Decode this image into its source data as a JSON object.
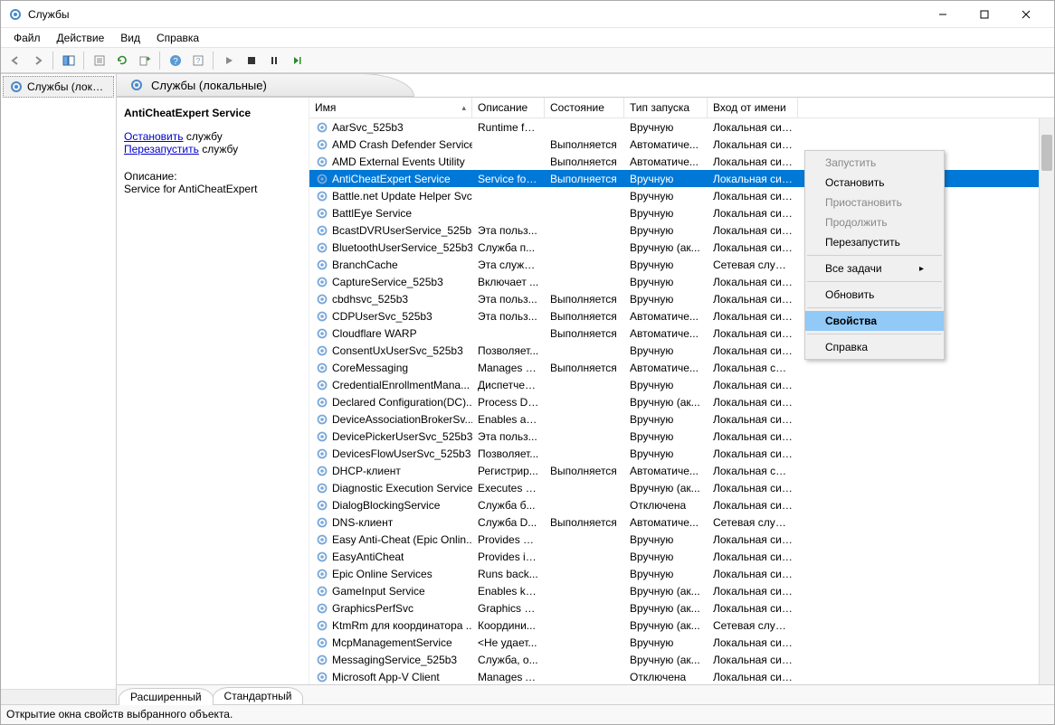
{
  "window": {
    "title": "Службы"
  },
  "menu": {
    "file": "Файл",
    "action": "Действие",
    "view": "Вид",
    "help": "Справка"
  },
  "tree": {
    "root": "Службы (локальные)"
  },
  "header": {
    "label": "Службы (локальные)"
  },
  "detail": {
    "title": "AntiCheatExpert Service",
    "stop_link": "Остановить",
    "stop_suffix": " службу",
    "restart_link": "Перезапустить",
    "restart_suffix": " службу",
    "desc_label": "Описание:",
    "desc_text": "Service for AntiCheatExpert"
  },
  "columns": {
    "name": "Имя",
    "desc": "Описание",
    "state": "Состояние",
    "start": "Тип запуска",
    "logon": "Вход от имени"
  },
  "services": [
    {
      "name": "AarSvc_525b3",
      "desc": "Runtime fo...",
      "state": "",
      "start": "Вручную",
      "logon": "Локальная сис..."
    },
    {
      "name": "AMD Crash Defender Service",
      "desc": "",
      "state": "Выполняется",
      "start": "Автоматиче...",
      "logon": "Локальная сис..."
    },
    {
      "name": "AMD External Events Utility",
      "desc": "",
      "state": "Выполняется",
      "start": "Автоматиче...",
      "logon": "Локальная сис..."
    },
    {
      "name": "AntiCheatExpert Service",
      "desc": "Service for ...",
      "state": "Выполняется",
      "start": "Вручную",
      "logon": "Локальная сис...",
      "selected": true
    },
    {
      "name": "Battle.net Update Helper Svc",
      "desc": "",
      "state": "",
      "start": "Вручную",
      "logon": "Локальная сис..."
    },
    {
      "name": "BattlEye Service",
      "desc": "",
      "state": "",
      "start": "Вручную",
      "logon": "Локальная сис..."
    },
    {
      "name": "BcastDVRUserService_525b3",
      "desc": "Эта польз...",
      "state": "",
      "start": "Вручную",
      "logon": "Локальная сис..."
    },
    {
      "name": "BluetoothUserService_525b3",
      "desc": "Служба п...",
      "state": "",
      "start": "Вручную (ак...",
      "logon": "Локальная сис..."
    },
    {
      "name": "BranchCache",
      "desc": "Эта служб...",
      "state": "",
      "start": "Вручную",
      "logon": "Сетевая служба"
    },
    {
      "name": "CaptureService_525b3",
      "desc": "Включает ...",
      "state": "",
      "start": "Вручную",
      "logon": "Локальная сис..."
    },
    {
      "name": "cbdhsvc_525b3",
      "desc": "Эта польз...",
      "state": "Выполняется",
      "start": "Вручную",
      "logon": "Локальная сис..."
    },
    {
      "name": "CDPUserSvc_525b3",
      "desc": "Эта польз...",
      "state": "Выполняется",
      "start": "Автоматиче...",
      "logon": "Локальная сис..."
    },
    {
      "name": "Cloudflare WARP",
      "desc": "",
      "state": "Выполняется",
      "start": "Автоматиче...",
      "logon": "Локальная сис..."
    },
    {
      "name": "ConsentUxUserSvc_525b3",
      "desc": "Позволяет...",
      "state": "",
      "start": "Вручную",
      "logon": "Локальная сис..."
    },
    {
      "name": "CoreMessaging",
      "desc": "Manages c...",
      "state": "Выполняется",
      "start": "Автоматиче...",
      "logon": "Локальная слу..."
    },
    {
      "name": "CredentialEnrollmentMana...",
      "desc": "Диспетчер...",
      "state": "",
      "start": "Вручную",
      "logon": "Локальная сис..."
    },
    {
      "name": "Declared Configuration(DC)...",
      "desc": "Process De...",
      "state": "",
      "start": "Вручную (ак...",
      "logon": "Локальная сис..."
    },
    {
      "name": "DeviceAssociationBrokerSv...",
      "desc": "Enables ap...",
      "state": "",
      "start": "Вручную",
      "logon": "Локальная сис..."
    },
    {
      "name": "DevicePickerUserSvc_525b3",
      "desc": "Эта польз...",
      "state": "",
      "start": "Вручную",
      "logon": "Локальная сис..."
    },
    {
      "name": "DevicesFlowUserSvc_525b3",
      "desc": "Позволяет...",
      "state": "",
      "start": "Вручную",
      "logon": "Локальная сис..."
    },
    {
      "name": "DHCP-клиент",
      "desc": "Регистрир...",
      "state": "Выполняется",
      "start": "Автоматиче...",
      "logon": "Локальная слу..."
    },
    {
      "name": "Diagnostic Execution Service",
      "desc": "Executes di...",
      "state": "",
      "start": "Вручную (ак...",
      "logon": "Локальная сис..."
    },
    {
      "name": "DialogBlockingService",
      "desc": "Служба б...",
      "state": "",
      "start": "Отключена",
      "logon": "Локальная сис..."
    },
    {
      "name": "DNS-клиент",
      "desc": "Служба D...",
      "state": "Выполняется",
      "start": "Автоматиче...",
      "logon": "Сетевая служба"
    },
    {
      "name": "Easy Anti-Cheat (Epic Onlin...",
      "desc": "Provides se...",
      "state": "",
      "start": "Вручную",
      "logon": "Локальная сис..."
    },
    {
      "name": "EasyAntiCheat",
      "desc": "Provides in...",
      "state": "",
      "start": "Вручную",
      "logon": "Локальная сис..."
    },
    {
      "name": "Epic Online Services",
      "desc": "Runs back...",
      "state": "",
      "start": "Вручную",
      "logon": "Локальная сис..."
    },
    {
      "name": "GameInput Service",
      "desc": "Enables ke...",
      "state": "",
      "start": "Вручную (ак...",
      "logon": "Локальная сис..."
    },
    {
      "name": "GraphicsPerfSvc",
      "desc": "Graphics p...",
      "state": "",
      "start": "Вручную (ак...",
      "logon": "Локальная сис..."
    },
    {
      "name": "KtmRm для координатора ...",
      "desc": "Координи...",
      "state": "",
      "start": "Вручную (ак...",
      "logon": "Сетевая служба"
    },
    {
      "name": "McpManagementService",
      "desc": "<Не удает...",
      "state": "",
      "start": "Вручную",
      "logon": "Локальная сис..."
    },
    {
      "name": "MessagingService_525b3",
      "desc": "Служба, о...",
      "state": "",
      "start": "Вручную (ак...",
      "logon": "Локальная сис..."
    },
    {
      "name": "Microsoft App-V Client",
      "desc": "Manages A...",
      "state": "",
      "start": "Отключена",
      "logon": "Локальная сис..."
    }
  ],
  "context_menu": {
    "start": "Запустить",
    "stop": "Остановить",
    "pause": "Приостановить",
    "resume": "Продолжить",
    "restart": "Перезапустить",
    "alltasks": "Все задачи",
    "refresh": "Обновить",
    "properties": "Свойства",
    "help": "Справка"
  },
  "tabs": {
    "extended": "Расширенный",
    "standard": "Стандартный"
  },
  "status": "Открытие окна свойств выбранного объекта."
}
